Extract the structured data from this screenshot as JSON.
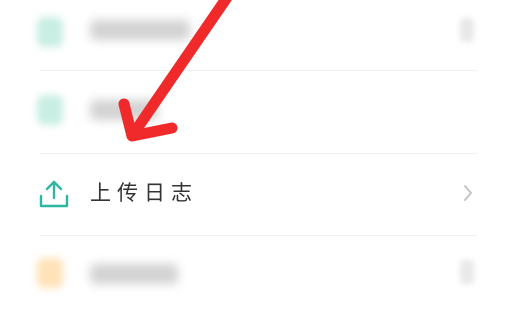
{
  "list": {
    "upload_log": {
      "label": "上传日志",
      "icon": "upload-icon",
      "accent_color": "#2fb7a4",
      "chevron_icon": "chevron-right-icon"
    }
  },
  "annotation": {
    "icon": "red-arrow-icon",
    "color": "#f02a2a"
  }
}
